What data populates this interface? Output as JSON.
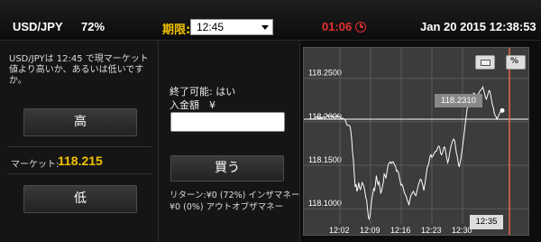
{
  "header": {
    "pair": "USD/JPY",
    "payout": "72%",
    "expiry_label": "期限:",
    "expiry_value": "12:45",
    "countdown": "01:06",
    "datetime": "Jan 20 2015   12:38:53"
  },
  "left": {
    "description": "USD/JPYは 12:45 で現マーケット値より高いか、あるいは低いですか。",
    "high_label": "高",
    "market_label": "マーケット:",
    "market_value": "118.215",
    "low_label": "低"
  },
  "middle": {
    "expiry_status": "終了可能: はい",
    "amount_label": "入金額　¥",
    "amount_value": "",
    "buy_label": "買う",
    "return_text": "リターン:¥0 (72%) インザマネー",
    "otm_text": "¥0 (0%) アウトオブザマネー"
  },
  "chart_controls": {
    "icon1": "chart-type-icon",
    "percent_label": "%"
  },
  "chart_data": {
    "type": "line",
    "title": "",
    "x_ticks": [
      "12:02",
      "12:09",
      "12:16",
      "12:23",
      "12:30"
    ],
    "y_ticks": [
      "118.2500",
      "118.2000",
      "118.1500",
      "118.1000"
    ],
    "ylim": [
      118.07,
      118.285
    ],
    "current_price_label": "118.2310",
    "current_time_label": "12:35",
    "grid": true,
    "x": [
      0,
      1,
      2,
      3,
      4,
      5,
      6,
      7,
      8,
      9,
      10,
      11,
      12,
      13,
      14,
      15,
      16,
      17,
      18,
      19,
      20,
      21,
      22,
      23,
      24,
      25,
      26,
      27,
      28,
      29,
      30,
      31,
      32,
      33,
      34,
      35,
      36,
      37,
      38,
      39,
      40,
      41,
      42,
      43,
      44,
      45,
      46,
      47,
      48,
      49,
      50,
      51,
      52,
      53,
      54,
      55,
      56,
      57,
      58,
      59,
      60,
      61,
      62,
      63,
      64,
      65,
      66,
      67,
      68,
      69,
      70,
      71,
      72,
      73,
      74,
      75,
      76,
      77,
      78,
      79,
      80,
      81,
      82,
      83,
      84,
      85,
      86,
      87,
      88,
      89,
      90,
      91,
      92,
      93,
      94,
      95,
      96,
      97,
      98,
      99,
      100,
      101,
      102,
      103,
      104,
      105,
      106,
      107,
      108,
      109,
      110,
      111,
      112,
      113,
      114,
      115,
      116,
      117,
      118,
      119,
      120,
      121,
      122,
      123,
      124,
      125,
      126,
      127,
      128,
      129,
      130,
      131,
      132,
      133,
      134,
      135,
      136,
      137,
      138,
      139,
      140,
      141,
      142,
      143,
      144,
      145,
      146,
      147,
      148,
      149,
      150,
      151,
      152,
      153,
      154,
      155,
      156,
      157,
      158,
      159,
      160,
      161,
      162,
      163,
      164,
      165,
      166,
      167,
      168,
      169,
      170,
      171,
      172,
      173,
      174,
      175,
      176,
      177,
      178,
      179,
      180,
      181,
      182,
      183,
      184,
      185,
      186,
      187,
      188,
      189,
      190,
      191,
      192,
      193,
      194,
      195,
      196,
      197,
      198,
      199,
      200,
      201,
      202,
      203,
      204,
      205,
      206,
      207,
      208,
      209,
      210,
      211,
      212,
      213
    ],
    "y": [
      118.205,
      118.205,
      118.206,
      118.205,
      118.205,
      118.204,
      118.205,
      118.205,
      118.204,
      118.205,
      118.206,
      118.205,
      118.205,
      118.206,
      118.206,
      118.207,
      118.206,
      118.206,
      118.207,
      118.206,
      118.206,
      118.206,
      118.205,
      118.206,
      118.206,
      118.206,
      118.207,
      118.206,
      118.206,
      118.205,
      118.204,
      118.203,
      118.204,
      118.203,
      118.203,
      118.201,
      118.198,
      118.196,
      118.196,
      118.196,
      118.195,
      118.19,
      118.18,
      118.165,
      118.155,
      118.14,
      118.125,
      118.128,
      118.12,
      118.123,
      118.13,
      118.124,
      118.122,
      118.126,
      118.13,
      118.128,
      118.125,
      118.12,
      118.113,
      118.11,
      118.1,
      118.09,
      118.088,
      118.093,
      118.103,
      118.112,
      118.118,
      118.123,
      118.121,
      118.128,
      118.138,
      118.132,
      118.128,
      118.131,
      118.125,
      118.118,
      118.12,
      118.126,
      118.131,
      118.14,
      118.138,
      118.135,
      118.142,
      118.148,
      118.152,
      118.153,
      118.154,
      118.152,
      118.153,
      118.154,
      118.152,
      118.15,
      118.148,
      118.143,
      118.144,
      118.142,
      118.137,
      118.132,
      118.127,
      118.128,
      118.126,
      118.122,
      118.118,
      118.116,
      118.114,
      118.11,
      118.108,
      118.104,
      118.11,
      118.114,
      118.117,
      118.118,
      118.12,
      118.118,
      118.116,
      118.115,
      118.12,
      118.124,
      118.128,
      118.131,
      118.134,
      118.133,
      118.13,
      118.126,
      118.121,
      118.128,
      118.134,
      118.142,
      118.148,
      118.15,
      118.154,
      118.16,
      118.162,
      118.159,
      118.16,
      118.162,
      118.164,
      118.166,
      118.166,
      118.168,
      118.171,
      118.172,
      118.17,
      118.164,
      118.162,
      118.164,
      118.168,
      118.171,
      118.17,
      118.164,
      118.158,
      118.153,
      118.156,
      118.162,
      118.168,
      118.173,
      118.176,
      118.179,
      118.18,
      118.178,
      118.171,
      118.164,
      118.16,
      118.153,
      118.148,
      118.152,
      118.157,
      118.165,
      118.172,
      118.18,
      118.188,
      118.198,
      118.206,
      118.214,
      118.217,
      118.222,
      118.225,
      118.228,
      118.23,
      118.231,
      118.232,
      118.233,
      118.232,
      118.23,
      118.228,
      118.229,
      118.232,
      118.234,
      118.236,
      118.237,
      118.238,
      118.24,
      118.236,
      118.232,
      118.228,
      118.226,
      118.229,
      118.233,
      118.236,
      118.235,
      118.23,
      118.224,
      118.219,
      118.216,
      118.21,
      118.207,
      118.206,
      118.203,
      118.205,
      118.207,
      118.21,
      118.211,
      118.212,
      118.213
    ]
  }
}
